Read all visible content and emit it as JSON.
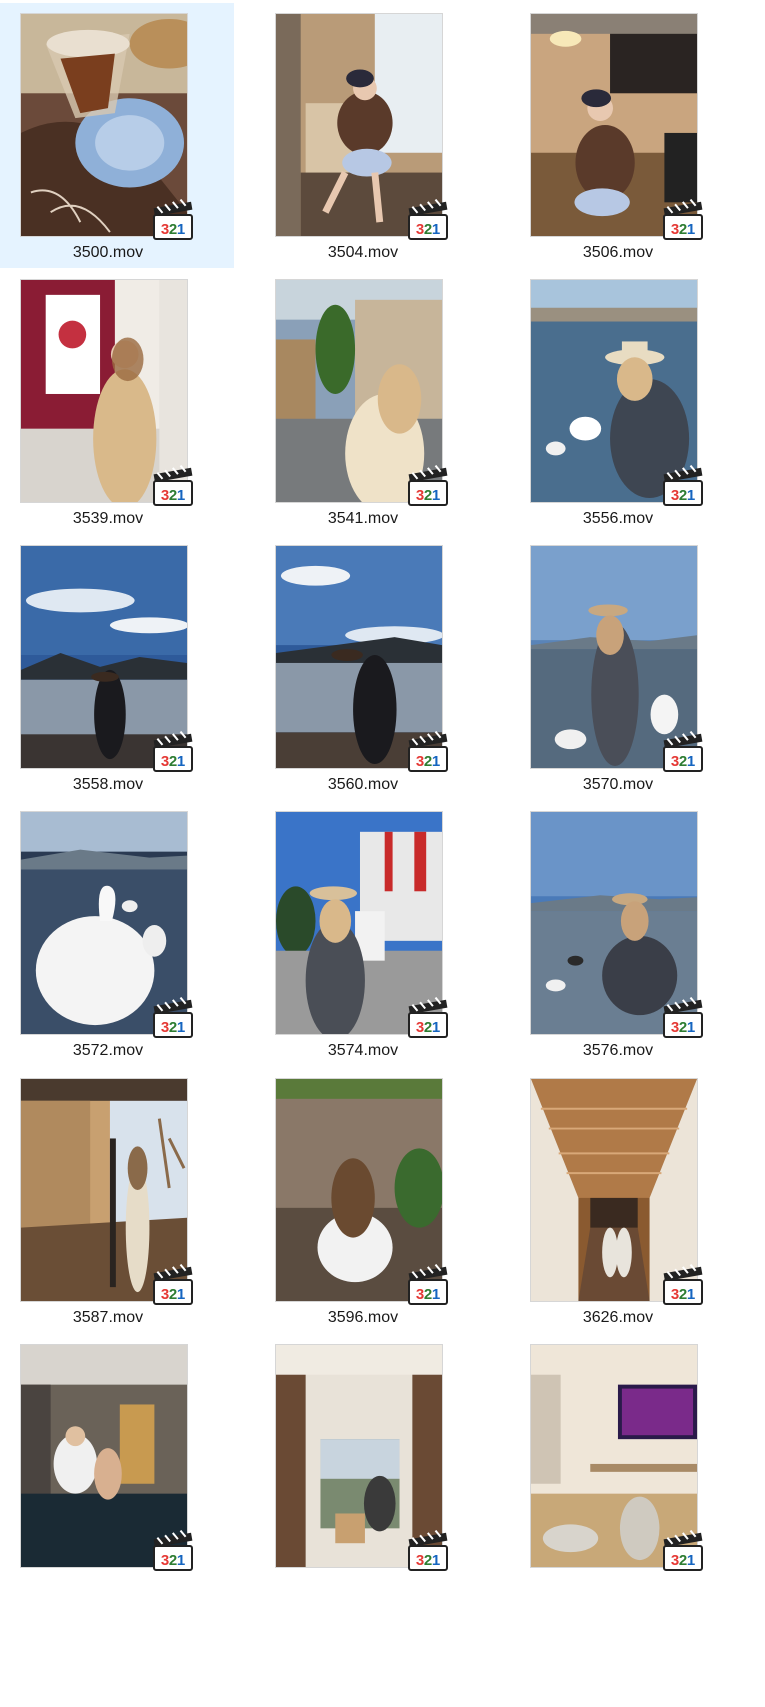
{
  "files": [
    {
      "name": "3500.mov",
      "selected": true,
      "scene": "coffee"
    },
    {
      "name": "3504.mov",
      "selected": false,
      "scene": "cafe-door"
    },
    {
      "name": "3506.mov",
      "selected": false,
      "scene": "cafe-counter"
    },
    {
      "name": "3539.mov",
      "selected": false,
      "scene": "gallery"
    },
    {
      "name": "3541.mov",
      "selected": false,
      "scene": "street"
    },
    {
      "name": "3556.mov",
      "selected": false,
      "scene": "lake-swans"
    },
    {
      "name": "3558.mov",
      "selected": false,
      "scene": "lake-walk"
    },
    {
      "name": "3560.mov",
      "selected": false,
      "scene": "lake-walk2"
    },
    {
      "name": "3570.mov",
      "selected": false,
      "scene": "lake-stand"
    },
    {
      "name": "3572.mov",
      "selected": false,
      "scene": "swan"
    },
    {
      "name": "3574.mov",
      "selected": false,
      "scene": "parking"
    },
    {
      "name": "3576.mov",
      "selected": false,
      "scene": "lake-crouch"
    },
    {
      "name": "3587.mov",
      "selected": false,
      "scene": "veranda"
    },
    {
      "name": "3596.mov",
      "selected": false,
      "scene": "deck"
    },
    {
      "name": "3626.mov",
      "selected": false,
      "scene": "corridor"
    },
    {
      "name": "",
      "selected": false,
      "scene": "bath"
    },
    {
      "name": "",
      "selected": false,
      "scene": "room-window"
    },
    {
      "name": "",
      "selected": false,
      "scene": "room-tv"
    }
  ],
  "badge": {
    "text": "321",
    "colors": [
      "#e53935",
      "#2e7d32",
      "#1565c0"
    ]
  },
  "colors": {
    "selection": "#e5f3ff",
    "label": "#1a1a1a"
  }
}
